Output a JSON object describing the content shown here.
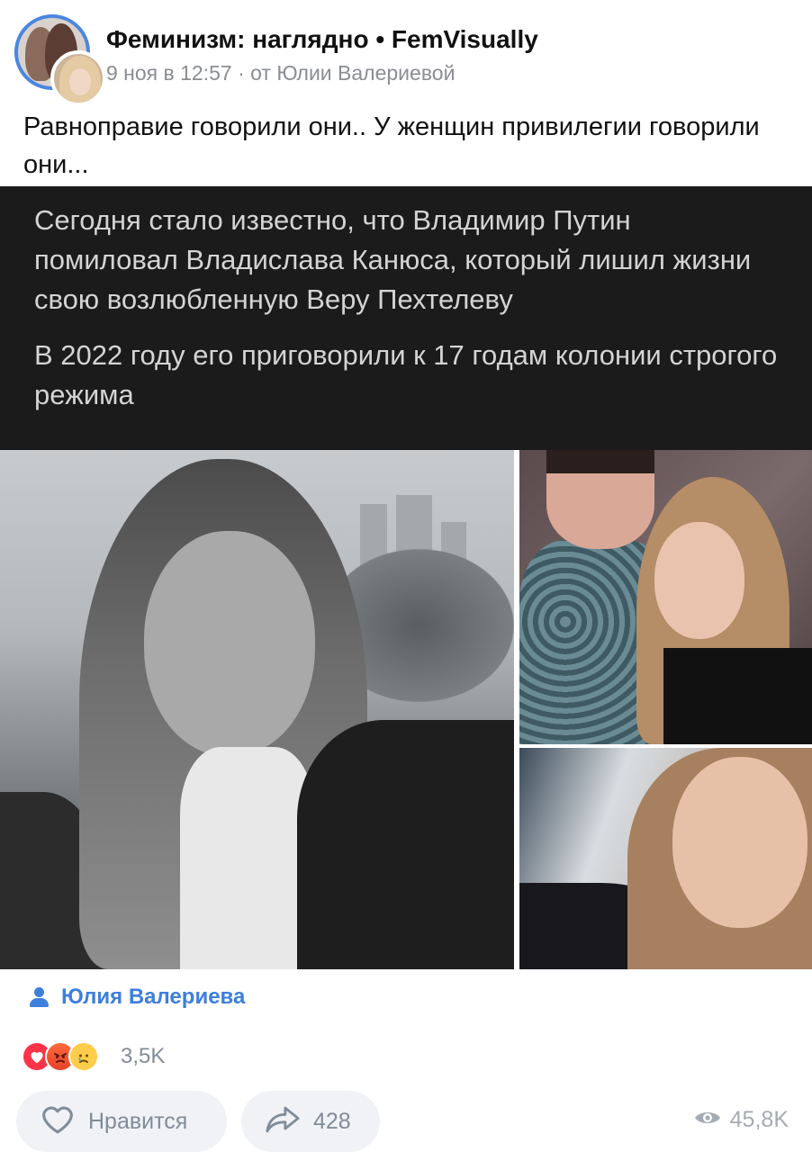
{
  "header": {
    "group_name": "Феминизм: наглядно • FemVisually",
    "meta": "9 ноя в 12:57 · от Юлии Валериевой"
  },
  "post": {
    "text": "Равноправие говорили они.. У женщин привилегии говорили они...",
    "image_text_1": "Сегодня стало известно, что Владимир Путин помиловал Владислава Канюса, который лишил жизни свою возлюбленную Веру Пехтелеву",
    "image_text_2": "В 2022 году его приговорили к 17 годам колонии строгого режима"
  },
  "author": {
    "name": "Юлия Валериева"
  },
  "reactions": {
    "count": "3,5K",
    "items": [
      "heart",
      "angry-face",
      "crying-face"
    ]
  },
  "actions": {
    "like_label": "Нравится",
    "share_count": "428",
    "views_count": "45,8K"
  },
  "colors": {
    "accent": "#3e7fdc",
    "avatar_ring": "#4a86e0",
    "secondary_text": "#818c99",
    "pill_bg": "#f0f2f5",
    "banner_bg": "#1b1b1b"
  }
}
